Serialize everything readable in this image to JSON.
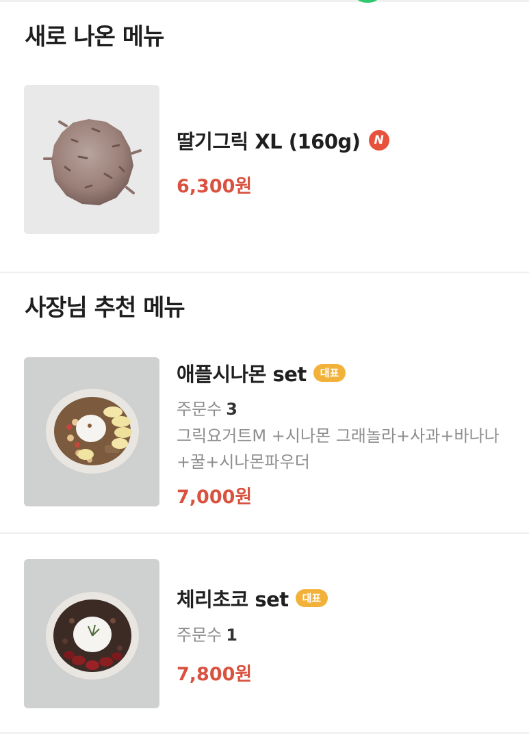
{
  "sections": [
    {
      "title": "새로 나온 메뉴",
      "items": [
        {
          "name": "딸기그릭 XL (160g)",
          "badge": "N",
          "price": "6,300원",
          "image_icon": "strawberry-greek-yogurt-scoop"
        }
      ]
    },
    {
      "title": "사장님 추천 메뉴",
      "items": [
        {
          "name": "애플시나몬 set",
          "badge": "대표",
          "orders_label": "주문수",
          "orders_count": "3",
          "description": "그릭요거트M +시나몬 그래놀라+사과+바나나+꿀+시나몬파우더",
          "price": "7,000원",
          "image_icon": "apple-cinnamon-bowl"
        },
        {
          "name": "체리초코 set",
          "badge": "대표",
          "orders_label": "주문수",
          "orders_count": "1",
          "price": "7,800원",
          "image_icon": "cherry-choco-bowl"
        }
      ]
    }
  ],
  "colors": {
    "price": "#d9523f",
    "badge_new": "#e8523d",
    "badge_rep": "#f2b23a"
  }
}
